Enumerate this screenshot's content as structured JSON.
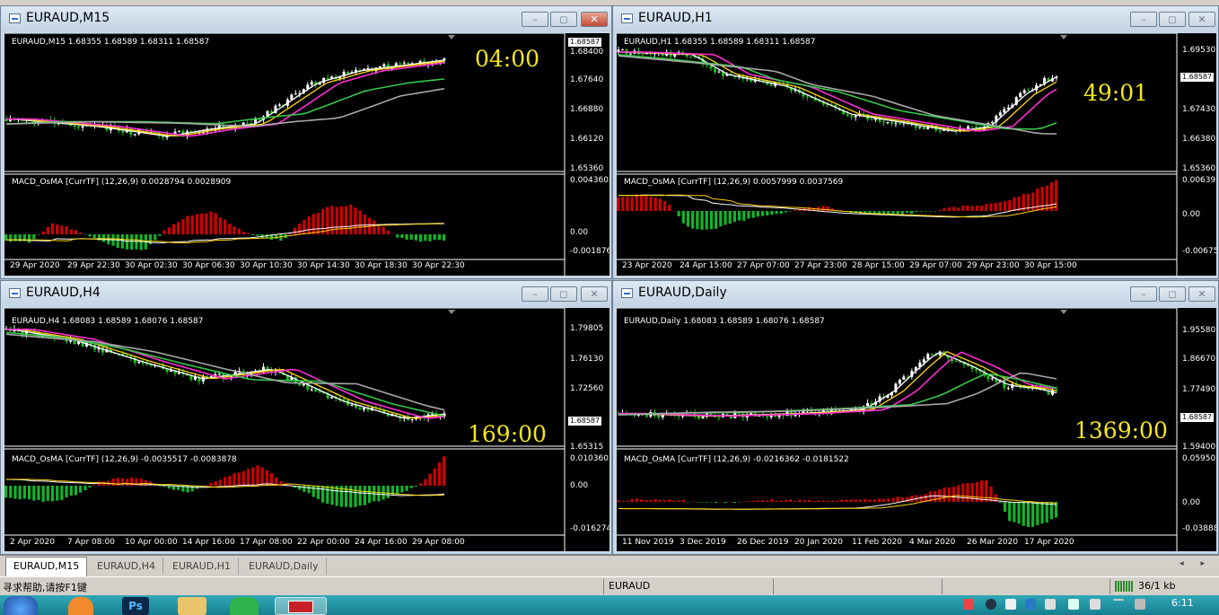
{
  "windows": [
    {
      "title": "EURAUD,M15",
      "info": "EURAUD,M15  1.68355 1.68589 1.68311 1.68587",
      "countdown": "04:00",
      "current_price": "1.68587",
      "price_ticks": [
        "1.68400",
        "1.67640",
        "1.66880",
        "1.66120",
        "1.65360"
      ],
      "macd_label": "MACD_OsMA [CurrTF] (12,26,9) 0.0028794 0.0028909",
      "macd_ticks": [
        "0.0043605",
        "0.00",
        "-0.001876"
      ],
      "time_ticks": [
        "29 Apr 2020",
        "29 Apr 22:30",
        "30 Apr 02:30",
        "30 Apr 06:30",
        "30 Apr 10:30",
        "30 Apr 14:30",
        "30 Apr 18:30",
        "30 Apr 22:30"
      ]
    },
    {
      "title": "EURAUD,H1",
      "info": "EURAUD,H1  1.68355 1.68589 1.68311 1.68587",
      "countdown": "49:01",
      "current_price": "1.68587",
      "price_ticks": [
        "1.69530",
        "1.67430",
        "1.66380",
        "1.65360"
      ],
      "macd_label": "MACD_OsMA [CurrTF] (12,26,9) 0.0057999 0.0037569",
      "macd_ticks": [
        "0.0063978",
        "0.00",
        "-0.006755"
      ],
      "time_ticks": [
        "23 Apr 2020",
        "24 Apr 15:00",
        "27 Apr 07:00",
        "27 Apr 23:00",
        "28 Apr 15:00",
        "29 Apr 07:00",
        "29 Apr 23:00",
        "30 Apr 15:00"
      ]
    },
    {
      "title": "EURAUD,H4",
      "info": "EURAUD,H4  1.68083 1.68589 1.68076 1.68587",
      "countdown": "169:00",
      "current_price": "1.68587",
      "price_ticks": [
        "1.79805",
        "1.76130",
        "1.72560",
        "1.68587",
        "1.65315"
      ],
      "macd_label": "MACD_OsMA [CurrTF] (12,26,9) -0.0035517 -0.0083878",
      "macd_ticks": [
        "0.0103607",
        "0.00",
        "-0.016274"
      ],
      "time_ticks": [
        "2 Apr 2020",
        "7 Apr 08:00",
        "10 Apr 00:00",
        "14 Apr 16:00",
        "17 Apr 08:00",
        "22 Apr 00:00",
        "24 Apr 16:00",
        "29 Apr 08:00"
      ]
    },
    {
      "title": "EURAUD,Daily",
      "info": "EURAUD,Daily  1.68083 1.68589 1.68076 1.68587",
      "countdown": "1369:00",
      "current_price": "1.68587",
      "price_ticks": [
        "1.95580",
        "1.86670",
        "1.77490",
        "1.68587",
        "1.59400"
      ],
      "macd_label": "MACD_OsMA [CurrTF] (12,26,9) -0.0216362 -0.0181522",
      "macd_ticks": [
        "0.0595038",
        "0.00",
        "-0.038889"
      ],
      "time_ticks": [
        "11 Nov 2019",
        "3 Dec 2019",
        "26 Dec 2019",
        "20 Jan 2020",
        "11 Feb 2020",
        "4 Mar 2020",
        "26 Mar 2020",
        "17 Apr 2020"
      ]
    }
  ],
  "window_buttons": {
    "minimize": "–",
    "restore": "◻",
    "close": "✕"
  },
  "tabs": [
    "EURAUD,M15",
    "EURAUD,H4",
    "EURAUD,H1",
    "EURAUD,Daily"
  ],
  "tab_arrows": "◂ ▸",
  "status": {
    "help": "寻求帮助,请按F1键",
    "symbol": "EURAUD",
    "traffic": "36/1 kb"
  },
  "taskbar": {
    "clock": "6:11",
    "ps_label": "Ps"
  },
  "colors": {
    "bull": "#ffffff",
    "bear": "#19c11a",
    "ma_fast": "#ffffff",
    "ma_yellow": "#ffd400",
    "ma_magenta": "#ff2bd4",
    "ma_green": "#33c84a",
    "ma_gray": "#a8a8a8",
    "osma_pos": "#d10000",
    "osma_neg": "#12b52a",
    "countdown": "#f5e81a"
  }
}
